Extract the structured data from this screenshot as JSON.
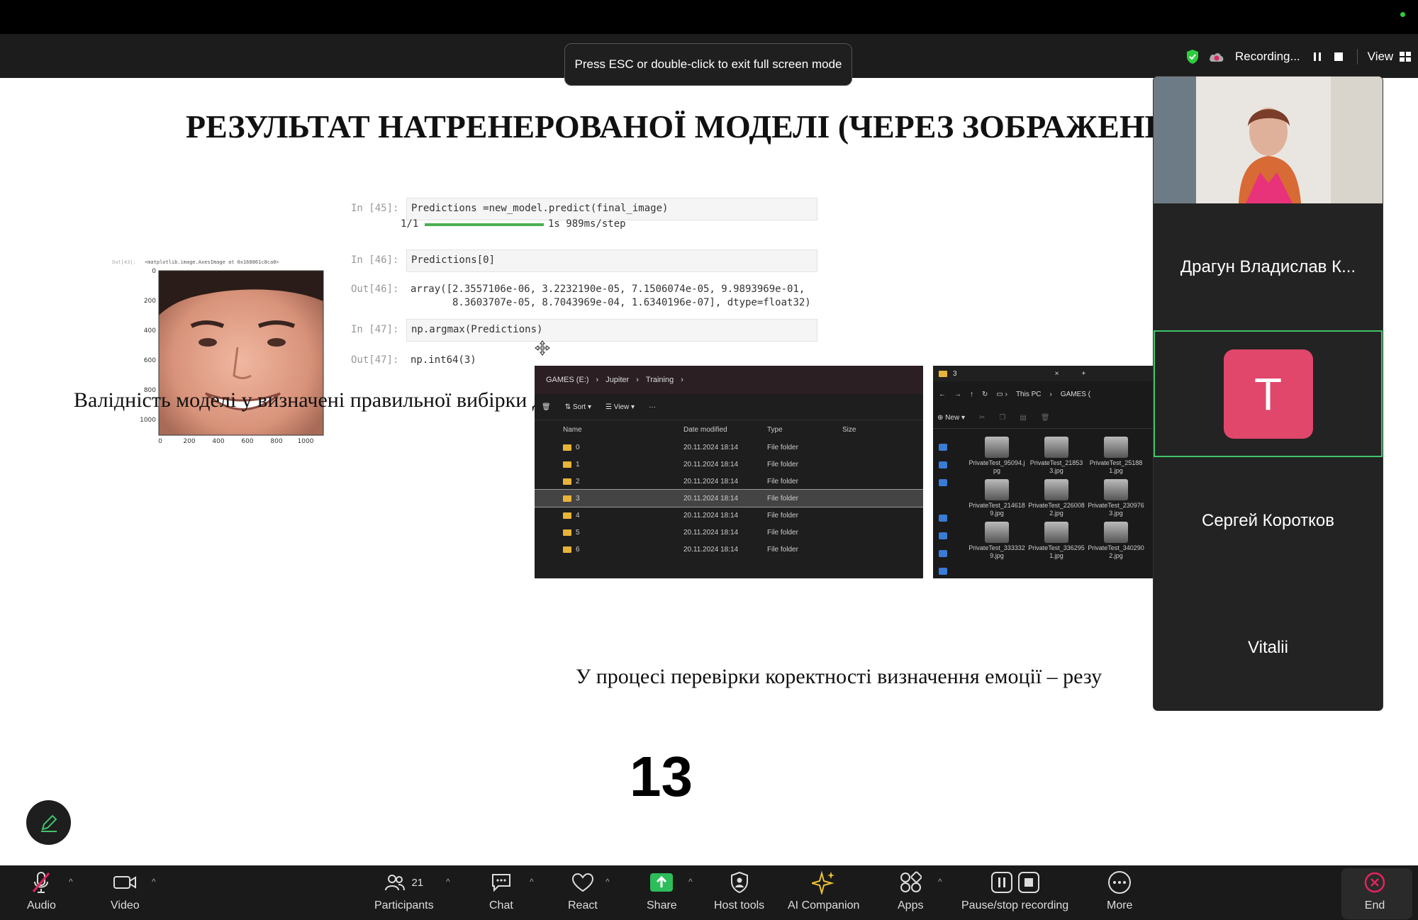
{
  "toast": {
    "text": "Press ESC or double-click to exit full screen mode"
  },
  "recording": {
    "label": "Recording...",
    "view_label": "View"
  },
  "slide": {
    "title": "РЕЗУЛЬТАТ НАТРЕНЕРОВАНОЇ МОДЕЛІ (ЧЕРЕЗ ЗОБРАЖЕНН",
    "plot": {
      "out_label": "Out[43]:",
      "obj_label": "<matplotlib.image.AxesImage at 0x168861c8ca0>",
      "y_ticks": [
        "0",
        "200",
        "400",
        "600",
        "800",
        "1000"
      ],
      "x_ticks": [
        "0",
        "200",
        "400",
        "600",
        "800",
        "1000"
      ]
    },
    "code": {
      "in45": "In [45]:",
      "cell45": "Predictions =new_model.predict(final_image)",
      "progress_count": "1/1",
      "progress_time": "1s 989ms/step",
      "in46": "In [46]:",
      "cell46": "Predictions[0]",
      "out46": "Out[46]:",
      "out46_line1": "array([2.3557106e-06, 3.2232190e-05, 7.1506074e-05, 9.9893969e-01,",
      "out46_line2": "       8.3603707e-05, 8.7043969e-04, 1.6340196e-07], dtype=float32)",
      "in47": "In [47]:",
      "cell47": "np.argmax(Predictions)",
      "out47": "Out[47]:",
      "out47_value": "np.int64(3)"
    },
    "validity_text": "Валідність моделі у визначені правильної вибірки даних із наданого масиву",
    "caption2": "У процесі перевірки коректності визначення емоції – резу",
    "page_number": "13"
  },
  "explorer1": {
    "breadcrumb": [
      "GAMES (E:)",
      "Jupiter",
      "Training"
    ],
    "sort_label": "Sort",
    "view_label": "View",
    "more_label": "···",
    "columns": [
      "Name",
      "Date modified",
      "Type",
      "Size"
    ],
    "rows": [
      {
        "name": "0",
        "date": "20.11.2024 18:14",
        "type": "File folder"
      },
      {
        "name": "1",
        "date": "20.11.2024 18:14",
        "type": "File folder"
      },
      {
        "name": "2",
        "date": "20.11.2024 18:14",
        "type": "File folder"
      },
      {
        "name": "3",
        "date": "20.11.2024 18:14",
        "type": "File folder"
      },
      {
        "name": "4",
        "date": "20.11.2024 18:14",
        "type": "File folder"
      },
      {
        "name": "5",
        "date": "20.11.2024 18:14",
        "type": "File folder"
      },
      {
        "name": "6",
        "date": "20.11.2024 18:14",
        "type": "File folder"
      }
    ],
    "selected_index": 3
  },
  "explorer2": {
    "tab_title": "3",
    "tab_close": "×",
    "tab_add": "+",
    "path": [
      "This PC",
      "GAMES ("
    ],
    "new_label": "New",
    "thumbs": [
      "PrivateTest_95094.jpg",
      "PrivateTest_218533.jpg",
      "PrivateTest_251881.jpg",
      "PrivateTest_2146189.jpg",
      "PrivateTest_2260082.jpg",
      "PrivateTest_2309763.jpg",
      "PrivateTest_3333329.jpg",
      "PrivateTest_3362951.jpg",
      "PrivateTest_3402902.jpg"
    ]
  },
  "participants_panel": {
    "tiles": [
      {
        "name": ""
      },
      {
        "name": "Драгун Владислав К..."
      },
      {
        "name": "",
        "avatar_letter": "T"
      },
      {
        "name": "Сергей Коротков"
      },
      {
        "name": "Vitalii"
      }
    ]
  },
  "toolbar": {
    "audio": "Audio",
    "video": "Video",
    "participants": "Participants",
    "participants_count": "21",
    "chat": "Chat",
    "react": "React",
    "share": "Share",
    "host_tools": "Host tools",
    "ai_companion": "AI Companion",
    "apps": "Apps",
    "pause_stop": "Pause/stop recording",
    "more": "More",
    "end": "End"
  },
  "colors": {
    "share_green": "#2dbd5a",
    "end_red": "#e0245e",
    "avatar_pink": "#e0476b",
    "active_outline": "#3fc46a"
  }
}
